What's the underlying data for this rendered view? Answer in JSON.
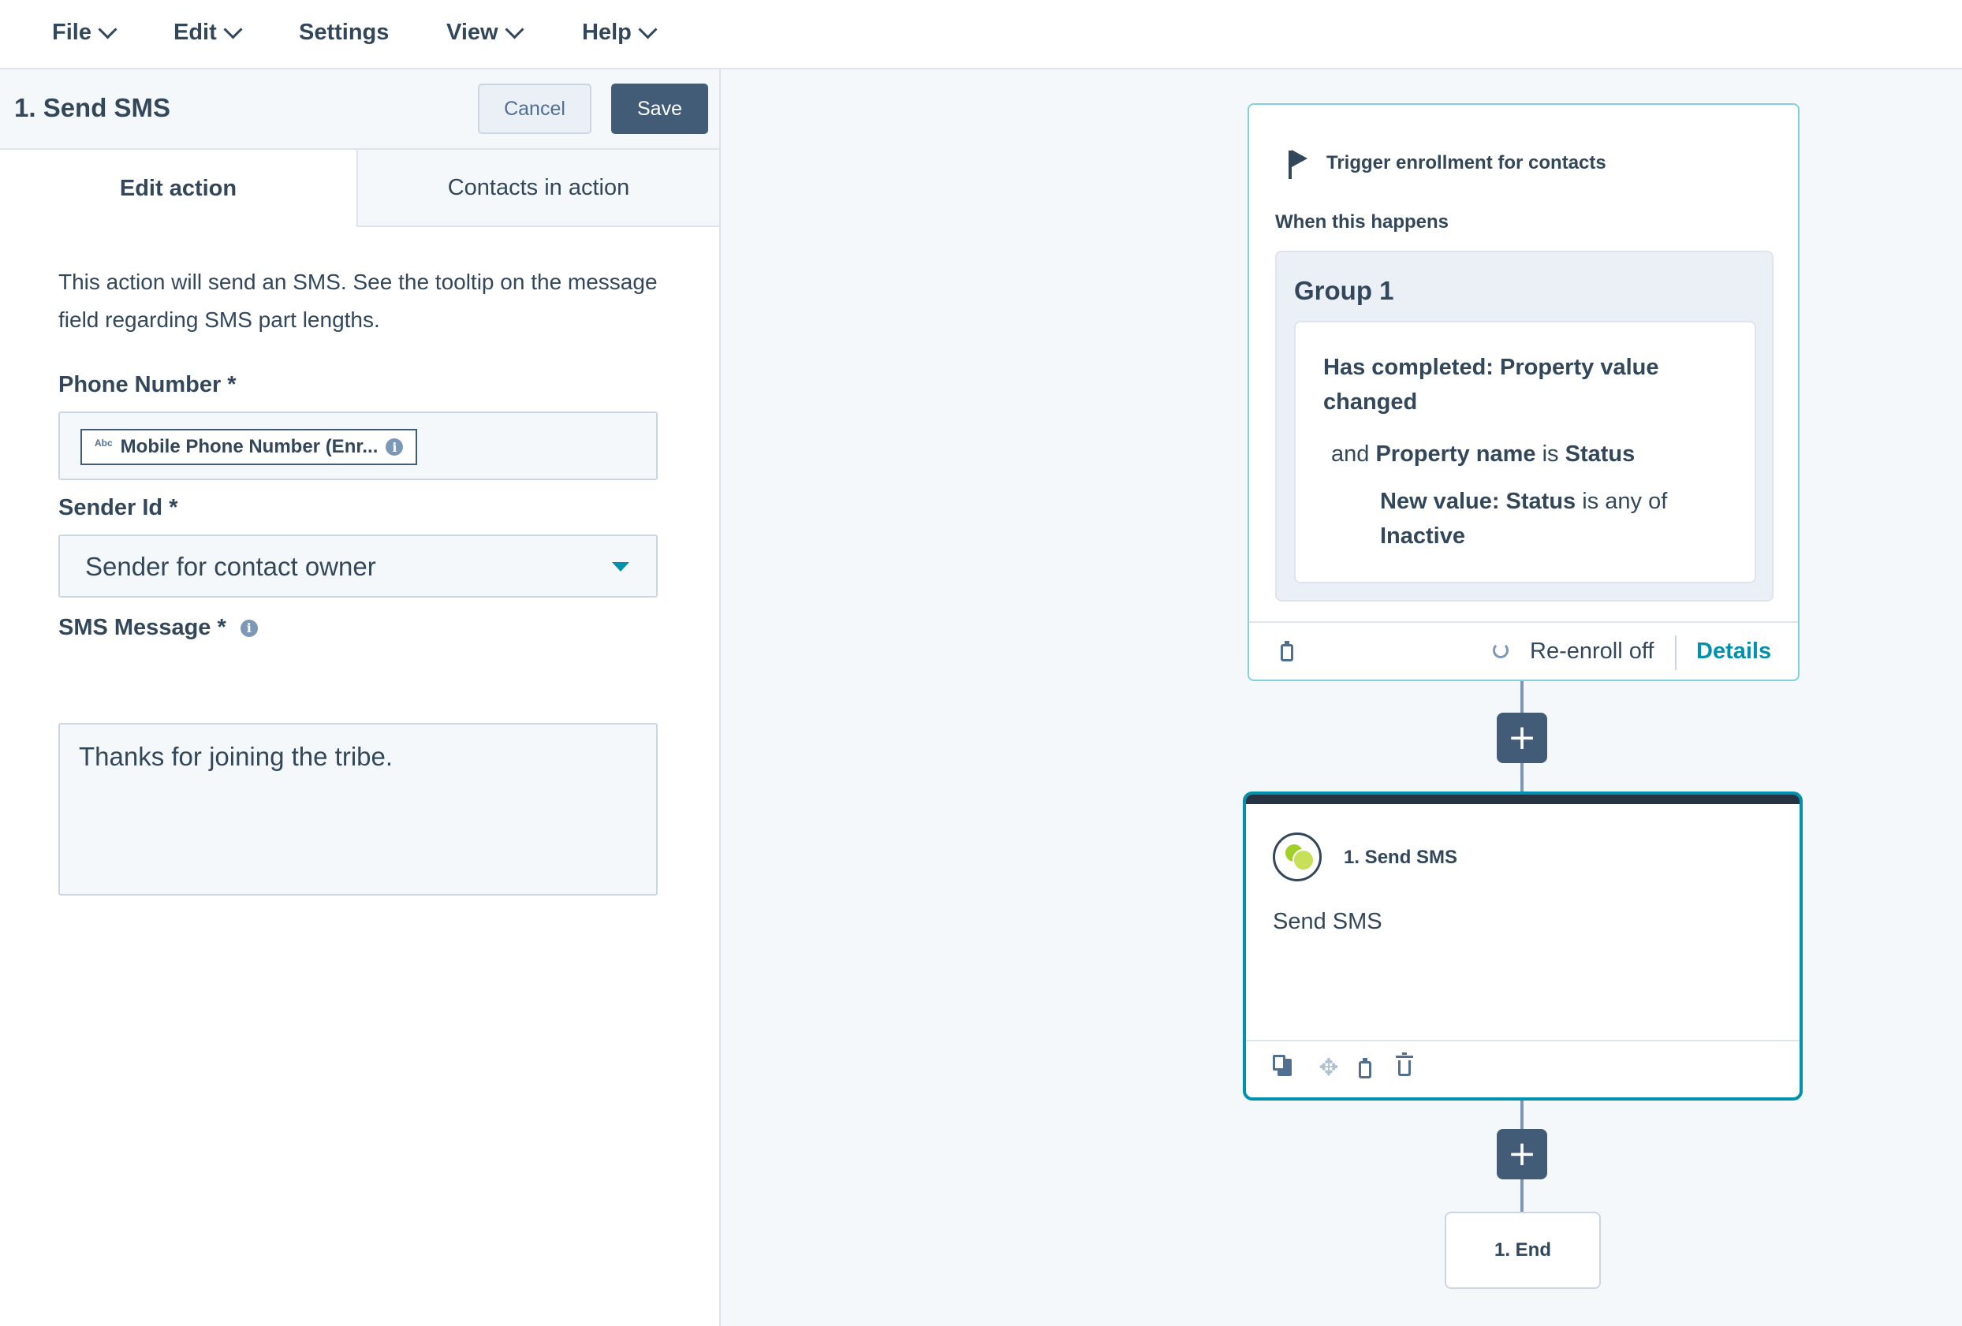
{
  "menu": {
    "file": "File",
    "edit": "Edit",
    "settings": "Settings",
    "view": "View",
    "help": "Help"
  },
  "panel": {
    "title": "1. Send SMS",
    "cancel_label": "Cancel",
    "save_label": "Save",
    "tabs": [
      {
        "label": "Edit action",
        "active": true
      },
      {
        "label": "Contacts in action",
        "active": false
      }
    ],
    "description": "This action will send an SMS. See the tooltip on the message field regarding SMS part lengths.",
    "phone": {
      "label": "Phone Number *",
      "token_type": "Abc",
      "token_label": "Mobile Phone Number (Enr..."
    },
    "sender": {
      "label": "Sender Id *",
      "value": "Sender for contact owner"
    },
    "message": {
      "label": "SMS Message *",
      "value": "Thanks for joining the tribe."
    }
  },
  "workflow": {
    "trigger": {
      "title": "Trigger enrollment for contacts",
      "when": "When this happens",
      "group_title": "Group 1",
      "criterion": {
        "line1": "Has completed: Property value changed",
        "and": "and",
        "prop_name_label": "Property name",
        "is": "is",
        "prop_name_value": "Status",
        "new_value_label": "New value: Status",
        "is_any_of": "is any of",
        "new_value": "Inactive"
      },
      "reenroll": "Re-enroll off",
      "details": "Details"
    },
    "add_button": "+",
    "action": {
      "title": "1. Send SMS",
      "description": "Send SMS"
    },
    "end": "1. End"
  },
  "colors": {
    "primary_dark": "#425b76",
    "accent_teal": "#0091ae",
    "trigger_border": "#7fd1de",
    "canvas_bg": "#f5f8fa",
    "sms_green": "#a2d028"
  },
  "icons": [
    "chevron-down-icon",
    "info-icon",
    "caret-down-icon",
    "flag-icon",
    "clipboard-icon",
    "refresh-icon",
    "plus-icon",
    "sms-icon",
    "copy-icon",
    "move-icon",
    "trash-icon"
  ]
}
